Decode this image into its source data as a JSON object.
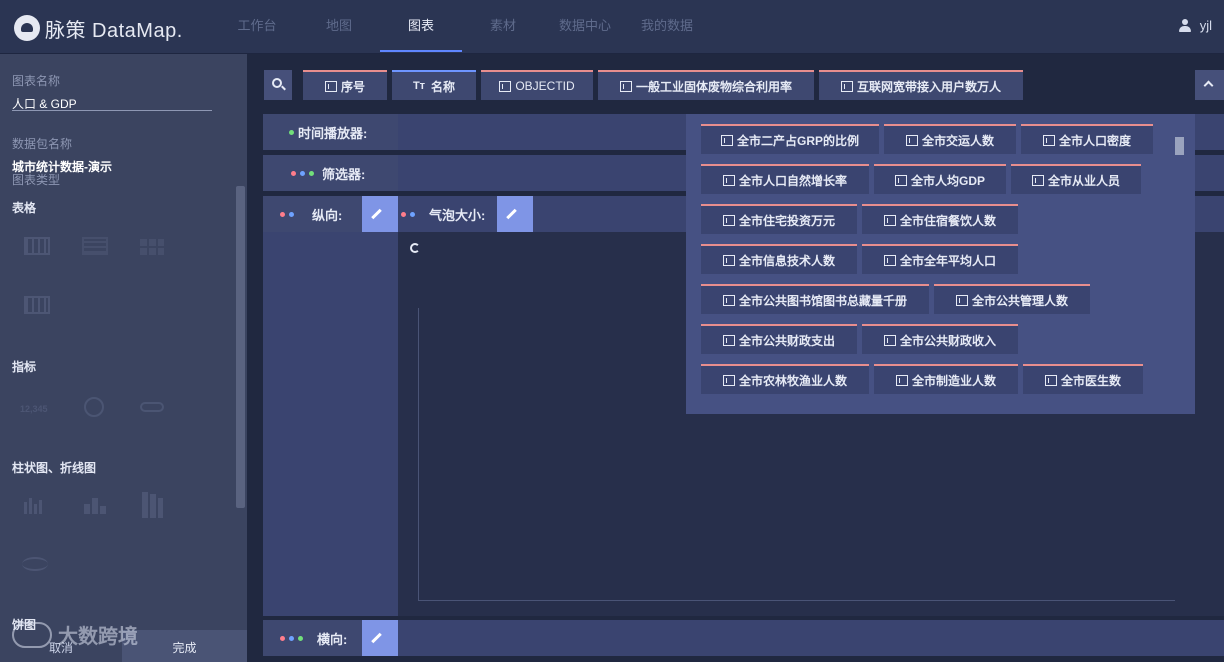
{
  "app": {
    "logo_text": "脉策 DataMap."
  },
  "nav": {
    "tabs": [
      "工作台",
      "地图",
      "图表",
      "素材",
      "数据中心",
      "我的数据"
    ],
    "active": "图表"
  },
  "user": {
    "name": "yjl"
  },
  "left_panel": {
    "chart_name_label": "图表名称",
    "chart_name_value": "人口 & GDP",
    "dataset_label": "数据包名称",
    "dataset_value": "城市统计数据-演示",
    "chart_type_label": "图表类型",
    "sections": {
      "table": "表格",
      "indicator": "指标",
      "bar_line": "柱状图、折线图",
      "pie": "饼图"
    },
    "indicator_sample": "12,345",
    "cancel": "取消",
    "done": "完成"
  },
  "watermark": "大数跨境",
  "fields": [
    {
      "label": "序号",
      "type": "number"
    },
    {
      "label": "名称",
      "type": "text",
      "prefix": "Tт"
    },
    {
      "label": "OBJECTID",
      "type": "number"
    },
    {
      "label": "一般工业固体废物综合利用率",
      "type": "number"
    },
    {
      "label": "互联网宽带接入用户数万人",
      "type": "number"
    }
  ],
  "rows": {
    "time_player": "时间播放器:",
    "filter": "筛选器:",
    "vertical": "纵向:",
    "bubble_size": "气泡大小:",
    "horizontal": "横向:"
  },
  "dropdown_items": [
    "全市二产占GRP的比例",
    "全市交运人数",
    "全市人口密度",
    "全市人口自然增长率",
    "全市人均GDP",
    "全市从业人员",
    "全市住宅投资万元",
    "全市住宿餐饮人数",
    "全市信息技术人数",
    "全市全年平均人口",
    "全市公共图书馆图书总藏量千册",
    "全市公共管理人数",
    "全市公共财政支出",
    "全市公共财政收入",
    "全市农林牧渔业人数",
    "全市制造业人数",
    "全市医生数"
  ],
  "colors": {
    "accent": "#5f86ff",
    "chip_border": "#e88e8e",
    "edit_button": "#7f95e6"
  }
}
